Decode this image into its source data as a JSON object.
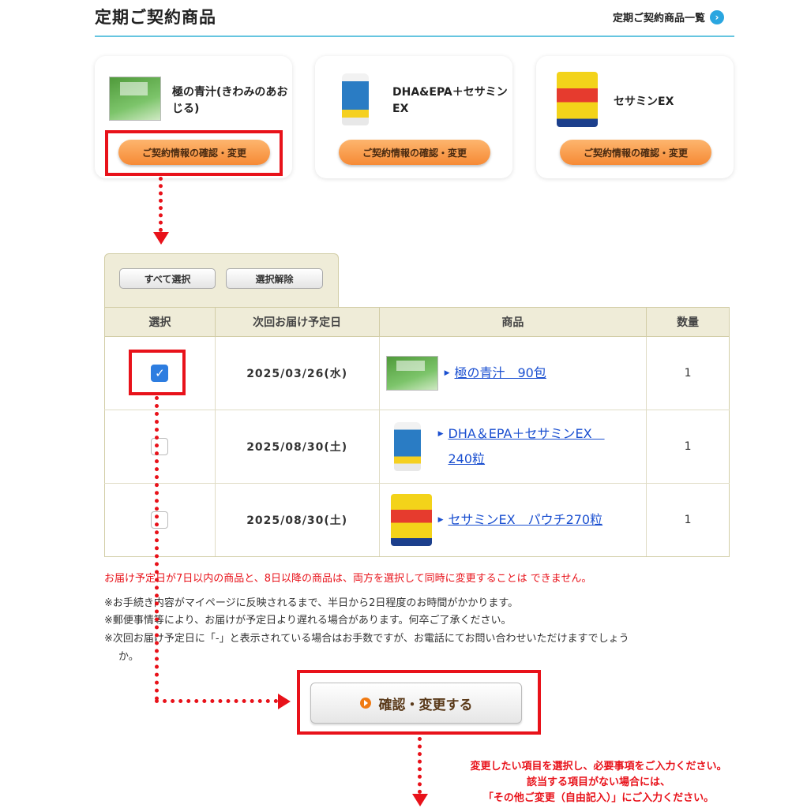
{
  "header": {
    "title": "定期ご契約商品",
    "list_link": "定期ご契約商品一覧"
  },
  "cards": [
    {
      "name": "極の青汁(きわみのあおじる)",
      "button": "ご契約情報の確認・変更",
      "image": "green-tea-box-image"
    },
    {
      "name": "DHA&EPA＋セサミンEX",
      "button": "ご契約情報の確認・変更",
      "image": "supplement-bottle-image"
    },
    {
      "name": "セサミンEX",
      "button": "ご契約情報の確認・変更",
      "image": "supplement-pouch-image"
    }
  ],
  "selection": {
    "select_all": "すべて選択",
    "deselect": "選択解除"
  },
  "table": {
    "headers": [
      "選択",
      "次回お届け予定日",
      "商品",
      "数量"
    ],
    "rows": [
      {
        "checked": true,
        "date": "2025/03/26(水)",
        "product_line1": "極の青汁　90包",
        "product_line2": "",
        "qty": "1"
      },
      {
        "checked": false,
        "date": "2025/08/30(土)",
        "product_line1": "DHA＆EPA＋セサミンEX　",
        "product_line2": "240粒",
        "qty": "1"
      },
      {
        "checked": false,
        "date": "2025/08/30(土)",
        "product_line1": "セサミンEX　パウチ270粒",
        "product_line2": "",
        "qty": "1"
      }
    ]
  },
  "notes": {
    "warning": "お届け予定日が7日以内の商品と、8日以降の商品は、両方を選択して同時に変更することは できません。",
    "note1": "※お手続き内容がマイページに反映されるまで、半日から2日程度のお時間がかかります。",
    "note2": "※郵便事情等により、お届けが予定日より遅れる場合があります。何卒ご了承ください。",
    "note3a": "※次回お届け予定日に「-」と表示されている場合はお手数ですが、お電話にてお問い合わせいただけますでしょう",
    "note3b": "か。"
  },
  "confirm_button": "確認・変更する",
  "bottom_note": {
    "line1": "変更したい項目を選択し、必要事項をご入力ください。",
    "line2": "該当する項目がない場合には、",
    "line3": "「その他ご変更（自由記入）」にご入力ください。"
  },
  "colors": {
    "accent_red": "#e8121a",
    "link_blue": "#1a4fd0",
    "button_orange": "#f68a35",
    "check_blue": "#2d7de0"
  }
}
